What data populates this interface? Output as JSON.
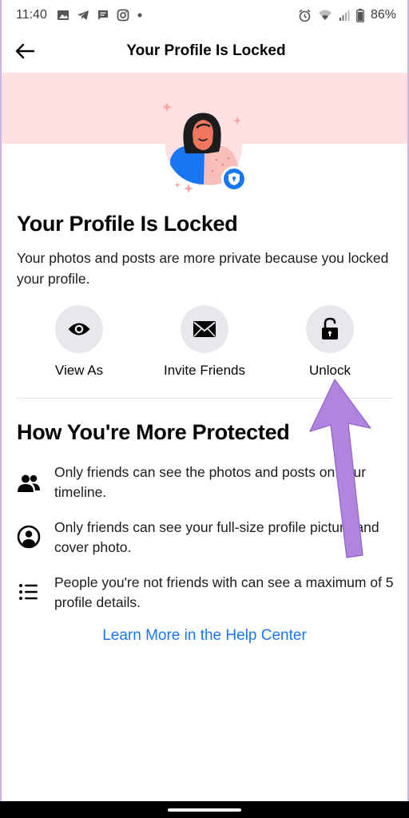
{
  "status_bar": {
    "time": "11:40",
    "battery_percent": "86%",
    "left_icons": [
      "image-icon",
      "telegram-icon",
      "message-icon",
      "instagram-icon",
      "dot-icon"
    ],
    "right_icons": [
      "alarm-icon",
      "wifi-icon",
      "signal-icon",
      "battery-icon"
    ]
  },
  "header": {
    "title": "Your Profile Is Locked"
  },
  "main": {
    "title": "Your Profile Is Locked",
    "description": "Your photos and posts are more private because you locked your profile.",
    "actions": [
      {
        "label": "View As",
        "icon": "eye-icon"
      },
      {
        "label": "Invite Friends",
        "icon": "envelope-icon"
      },
      {
        "label": "Unlock",
        "icon": "unlock-icon"
      }
    ],
    "protection_title": "How You're More Protected",
    "protection_items": [
      {
        "text": "Only friends can see the photos and posts on your timeline.",
        "icon": "friends-icon"
      },
      {
        "text": "Only friends can see your full-size profile picture and cover photo.",
        "icon": "profile-circle-icon"
      },
      {
        "text": "People you're not friends with can see a maximum of 5 profile details.",
        "icon": "list-icon"
      }
    ],
    "help_link": "Learn More in the Help Center"
  },
  "colors": {
    "banner": "#fde0df",
    "link": "#1877f2",
    "action_circle": "#e6e8ec",
    "arrow": "#b184e0"
  }
}
